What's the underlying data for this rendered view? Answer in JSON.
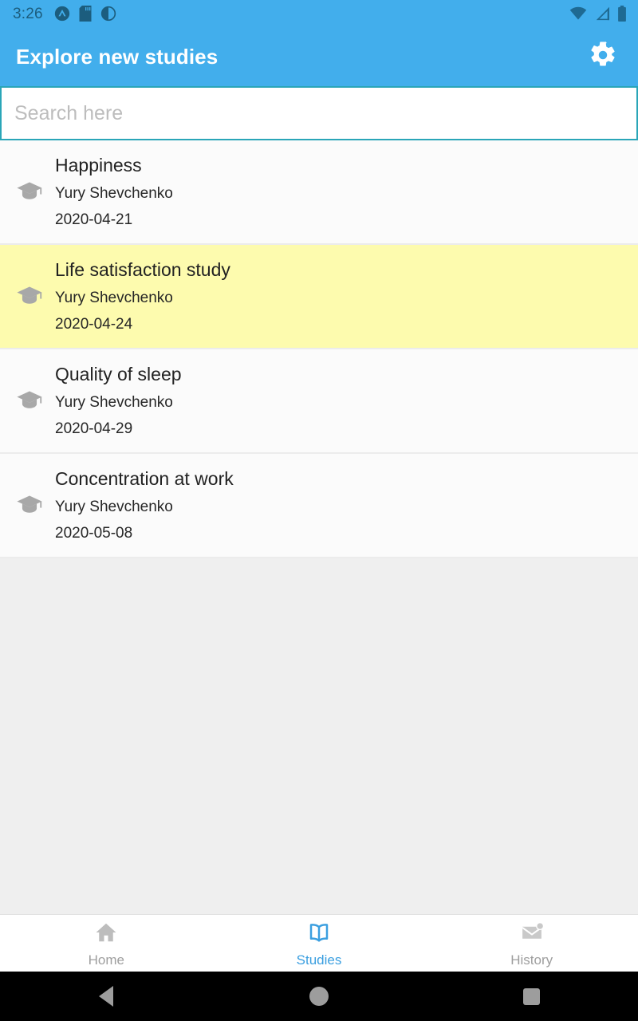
{
  "status_bar": {
    "time": "3:26",
    "left_icons": [
      "notification-circle-icon",
      "sd-card-icon",
      "brightness-half-icon"
    ],
    "right_icons": [
      "wifi-icon",
      "cellular-signal-icon",
      "battery-icon"
    ],
    "icon_color": "#1c5d7e"
  },
  "app_bar": {
    "title": "Explore new studies",
    "settings_icon": "gear-icon",
    "background": "#42aeec",
    "title_color": "#ffffff"
  },
  "search": {
    "value": "",
    "placeholder": "Search here",
    "border_color": "#2aa6b8"
  },
  "studies": {
    "icon": "graduation-cap-icon",
    "highlight_color": "#fdfbae",
    "items": [
      {
        "title": "Happiness",
        "author": "Yury Shevchenko",
        "date": "2020-04-21",
        "highlighted": false
      },
      {
        "title": "Life satisfaction study",
        "author": "Yury Shevchenko",
        "date": "2020-04-24",
        "highlighted": true
      },
      {
        "title": "Quality of sleep",
        "author": "Yury Shevchenko",
        "date": "2020-04-29",
        "highlighted": false
      },
      {
        "title": "Concentration at work",
        "author": "Yury Shevchenko",
        "date": "2020-05-08",
        "highlighted": false
      }
    ]
  },
  "bottom_nav": {
    "active_color": "#3b9fe0",
    "inactive_color": "#9e9e9e",
    "items": [
      {
        "label": "Home",
        "icon": "home-icon",
        "active": false,
        "badge": false
      },
      {
        "label": "Studies",
        "icon": "book-icon",
        "active": true,
        "badge": false
      },
      {
        "label": "History",
        "icon": "envelope-icon",
        "active": false,
        "badge": true
      }
    ]
  },
  "android_nav": {
    "buttons": [
      "back-button",
      "home-button",
      "recents-button"
    ]
  }
}
